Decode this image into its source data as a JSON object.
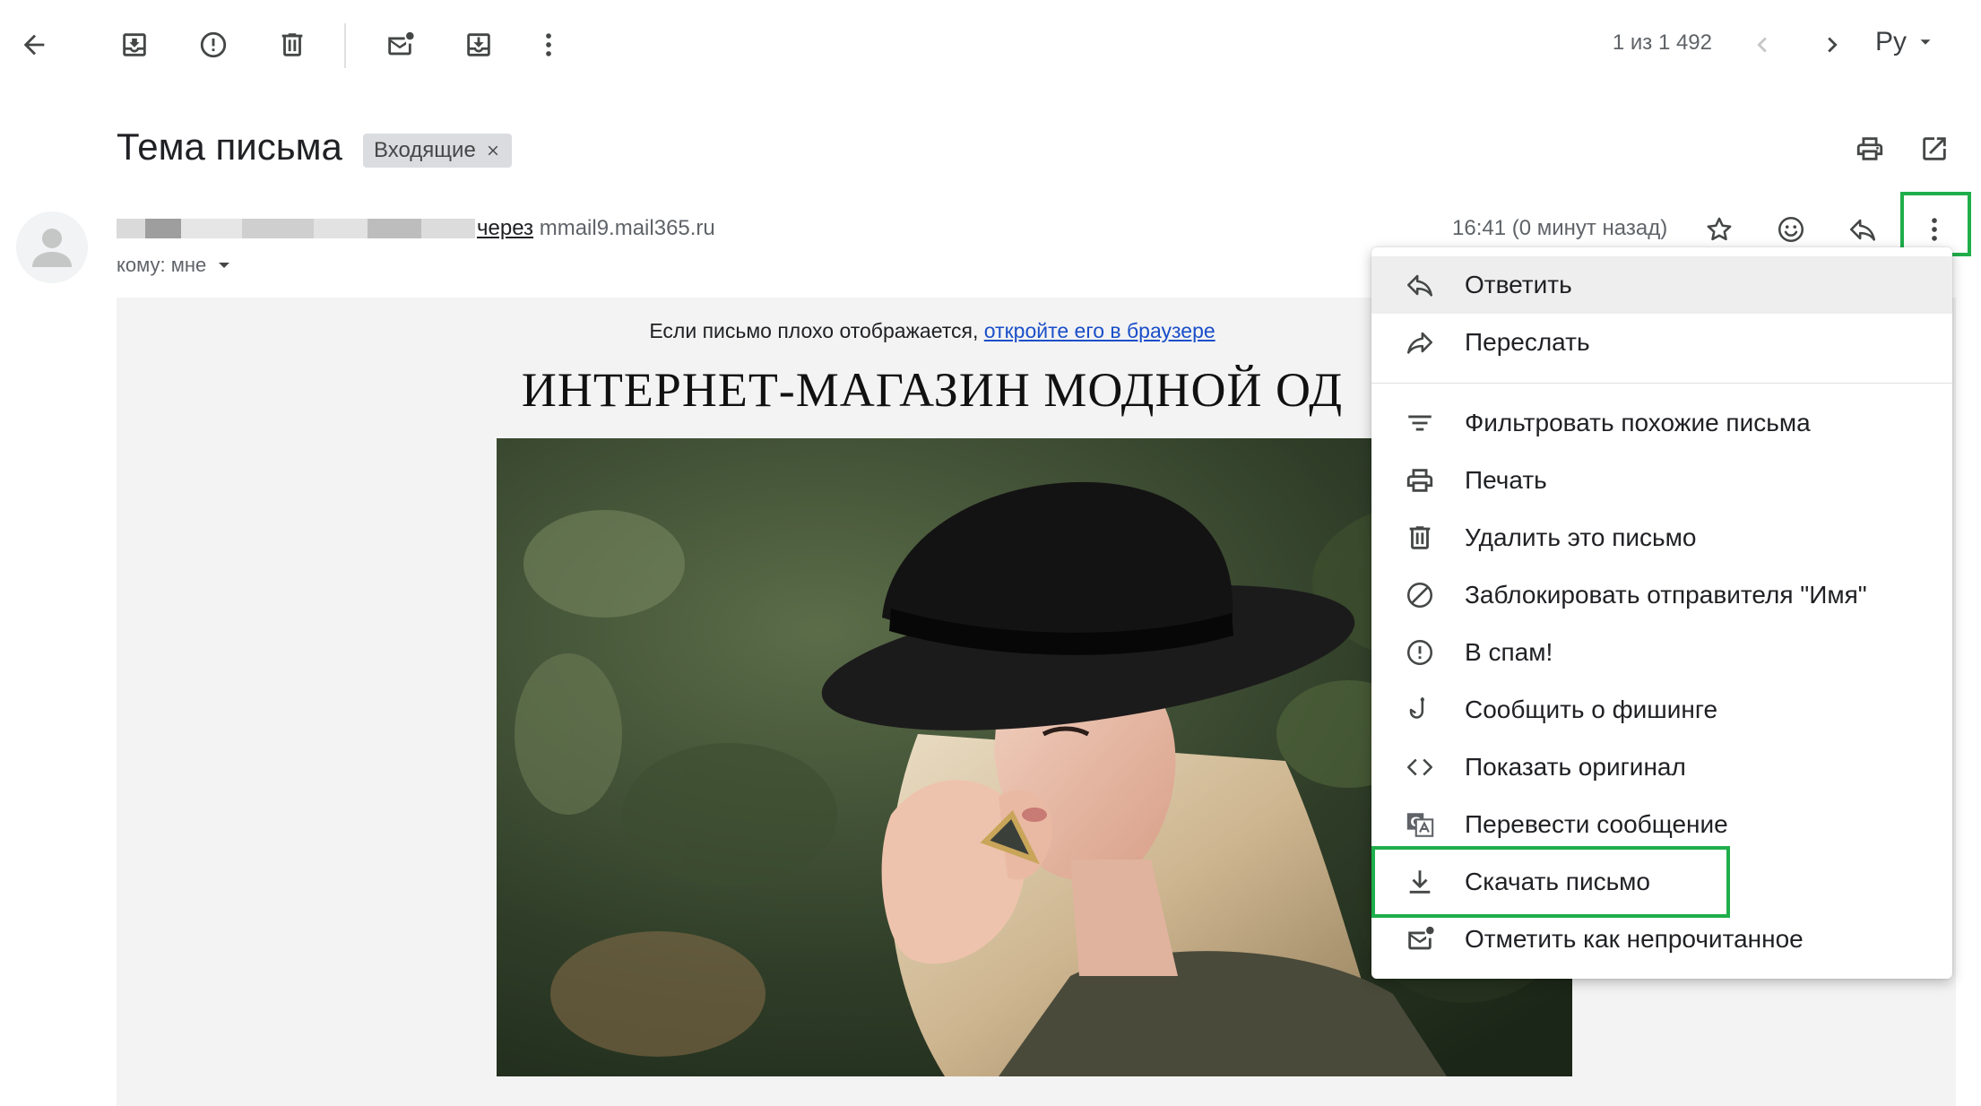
{
  "toolbar": {
    "icons": [
      "back-arrow-icon",
      "archive-icon",
      "report-spam-icon",
      "delete-icon",
      "mark-unread-icon",
      "move-to-icon",
      "more-vert-icon"
    ],
    "pager": "1 из 1 492",
    "language": "Ру"
  },
  "message": {
    "subject": "Тема письма",
    "label": "Входящие",
    "via_word": "через",
    "via_domain": "mmail9.mail365.ru",
    "to": "кому: мне",
    "time": "16:41 (0 минут назад)"
  },
  "email": {
    "preheader_text": "Если письмо плохо отображается, ",
    "preheader_link": "откройте его в браузере",
    "headline": "ИНТЕРНЕТ-МАГАЗИН МОДНОЙ ОД"
  },
  "menu": {
    "items": [
      {
        "label": "Ответить",
        "icon": "reply-icon"
      },
      {
        "label": "Переслать",
        "icon": "forward-icon"
      },
      {
        "label": "Фильтровать похожие письма",
        "icon": "filter-icon"
      },
      {
        "label": "Печать",
        "icon": "print-icon"
      },
      {
        "label": "Удалить это письмо",
        "icon": "delete-icon"
      },
      {
        "label": "Заблокировать отправителя \"Имя\"",
        "icon": "block-icon"
      },
      {
        "label": "В спам!",
        "icon": "report-spam-icon"
      },
      {
        "label": "Сообщить о фишинге",
        "icon": "phishing-hook-icon"
      },
      {
        "label": "Показать оригинал",
        "icon": "code-icon"
      },
      {
        "label": "Перевести сообщение",
        "icon": "translate-icon"
      },
      {
        "label": "Скачать письмо",
        "icon": "download-icon"
      },
      {
        "label": "Отметить как непрочитанное",
        "icon": "mark-unread-icon"
      }
    ]
  },
  "colors": {
    "highlight_box": "#1fae4b",
    "link": "#1a4fc9",
    "menu_hover": "#eeeeee"
  }
}
